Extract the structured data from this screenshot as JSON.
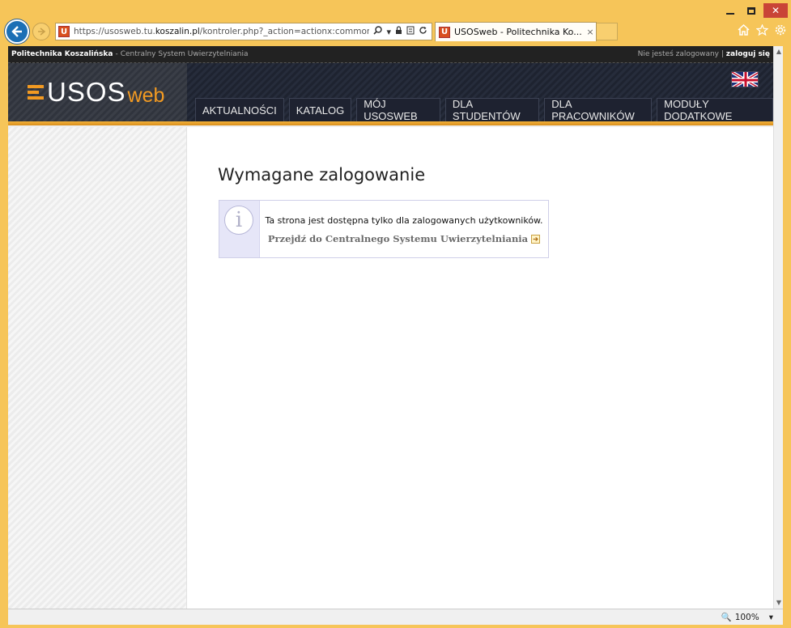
{
  "browser": {
    "url_prefix": "https://usosweb.tu.",
    "url_domain": "koszalin.pl",
    "url_rest": "/kontroler.php?_action=actionx:common/komun",
    "tab_title": "USOSweb - Politechnika Ko...",
    "tab_close": "×",
    "favicon_letter": "U",
    "zoom": "100%",
    "zoom_icon": "🔍",
    "zoom_dropdown": "▾",
    "icons": [
      "back-icon",
      "forward-icon",
      "search-icon",
      "lock-icon",
      "refresh-icon",
      "home-icon",
      "star-icon",
      "gear-icon"
    ]
  },
  "topbar": {
    "university": "Politechnika Koszalińska",
    "separator": "-",
    "system": "Centralny System Uwierzytelniania",
    "login_status": "Nie jesteś zalogowany",
    "divider": "|",
    "login_link": "zaloguj się"
  },
  "logo": {
    "main": "USOS",
    "suffix": "web"
  },
  "nav": [
    "AKTUALNOŚCI",
    "KATALOG",
    "MÓJ USOSWEB",
    "DLA STUDENTÓW",
    "DLA PRACOWNIKÓW",
    "MODUŁY DODATKOWE"
  ],
  "content": {
    "title": "Wymagane zalogowanie",
    "info_glyph": "i",
    "message": "Ta strona jest dostępna tylko dla zalogowanych użytkowników.",
    "link_text": "Przejdź do Centralnego Systemu Uwierzytelniania",
    "link_arrow": "➔"
  },
  "colors": {
    "frame": "#f6c559",
    "header_dark": "#1e2330",
    "accent_orange": "#f29a22",
    "info_bg": "#e6e6f8"
  }
}
